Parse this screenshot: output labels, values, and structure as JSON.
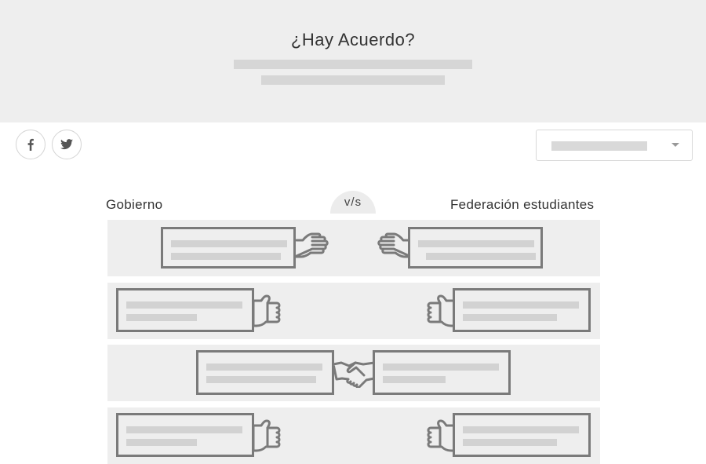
{
  "header": {
    "title": "¿Hay Acuerdo?"
  },
  "social": {
    "facebook_icon": "facebook-icon",
    "twitter_icon": "twitter-icon"
  },
  "filter": {
    "icon": "chevron-down-icon"
  },
  "comparison": {
    "left_label": "Gobierno",
    "vs_label": "v/s",
    "right_label": "Federación estudiantes",
    "rows": [
      {
        "left_hand": "open-hand-right-icon",
        "right_hand": "open-hand-left-icon",
        "state": "reaching"
      },
      {
        "left_hand": "fist-right-icon",
        "right_hand": "fist-left-icon",
        "state": "apart"
      },
      {
        "center_icon": "handshake-icon",
        "state": "agreement"
      },
      {
        "left_hand": "fist-right-icon",
        "right_hand": "fist-left-icon",
        "state": "apart"
      }
    ]
  },
  "colors": {
    "header_bg": "#eeeeee",
    "row_bg": "#eeeeee",
    "card_border": "#7a7a7a",
    "placeholder": "#d2d2d2"
  }
}
